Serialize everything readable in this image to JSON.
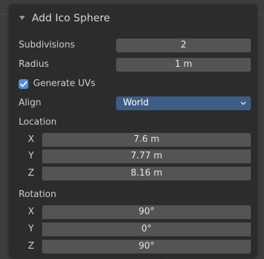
{
  "panel": {
    "title": "Add Ico Sphere"
  },
  "subdivisions": {
    "label": "Subdivisions",
    "value": "2"
  },
  "radius": {
    "label": "Radius",
    "value": "1 m"
  },
  "generate_uvs": {
    "label": "Generate UVs",
    "checked": true
  },
  "align": {
    "label": "Align",
    "value": "World"
  },
  "location": {
    "label": "Location",
    "x": {
      "axis": "X",
      "value": "7.6 m"
    },
    "y": {
      "axis": "Y",
      "value": "7.77 m"
    },
    "z": {
      "axis": "Z",
      "value": "8.16 m"
    }
  },
  "rotation": {
    "label": "Rotation",
    "x": {
      "axis": "X",
      "value": "90°"
    },
    "y": {
      "axis": "Y",
      "value": "0°"
    },
    "z": {
      "axis": "Z",
      "value": "90°"
    }
  },
  "colors": {
    "panel_bg": "#2c2c2c",
    "field_bg": "#545454",
    "accent": "#4f8fd6",
    "dropdown_bg": "#3e5d84"
  },
  "icons": {
    "collapse": "chevron-down-icon",
    "checkbox": "checkmark-icon",
    "dropdown": "chevron-down-icon"
  }
}
